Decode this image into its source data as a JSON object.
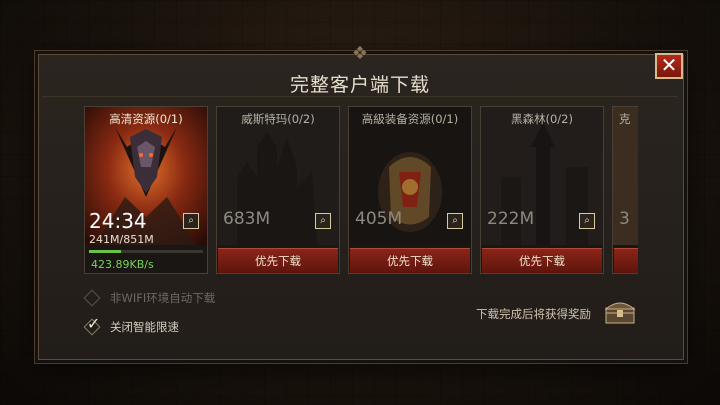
{
  "dialog": {
    "title": "完整客户端下载",
    "close_label": "✕"
  },
  "cards": [
    {
      "name": "高清资源(0/1)",
      "timer": "24:34",
      "progress_text": "241M/851M",
      "progress": 0.283,
      "speed": "423.89KB/s"
    },
    {
      "name": "威斯特玛(0/2)",
      "size": "683M",
      "button": "优先下载"
    },
    {
      "name": "高級装备资源(0/1)",
      "size": "405M",
      "button": "优先下载"
    },
    {
      "name": "黑森林(0/2)",
      "size": "222M",
      "button": "优先下载"
    },
    {
      "name": "克",
      "size": "3",
      "button": ""
    }
  ],
  "options": {
    "wifi_label": "非WIFI环境自动下载",
    "wifi_checked": false,
    "limit_label": "关闭智能限速",
    "limit_checked": true
  },
  "reward_text": "下载完成后将获得奖励",
  "icons": {
    "magnifier": "magnifier-icon",
    "chest": "treasure-chest-icon",
    "crest": "crest-icon"
  }
}
